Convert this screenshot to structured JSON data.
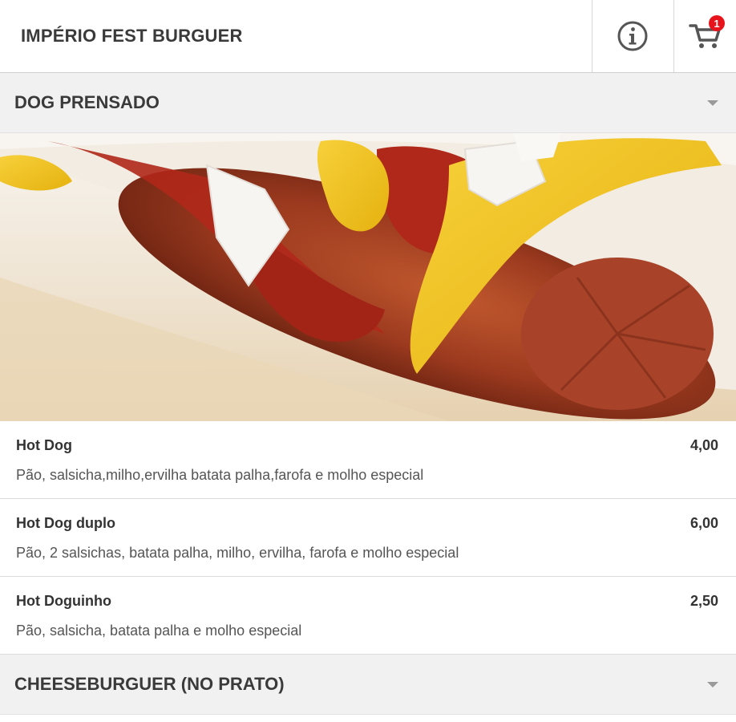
{
  "header": {
    "title": "IMPÉRIO FEST BURGUER",
    "info_icon": "info-icon",
    "cart_icon": "cart-icon",
    "cart_count": "1"
  },
  "categories": [
    {
      "title": "DOG PRENSADO",
      "items": [
        {
          "name": "Hot Dog",
          "description": "Pão, salsicha,milho,ervilha batata palha,farofa e molho especial",
          "price": "4,00"
        },
        {
          "name": "Hot Dog duplo",
          "description": "Pão, 2 salsichas, batata palha, milho, ervilha, farofa e molho especial",
          "price": "6,00"
        },
        {
          "name": "Hot Doguinho",
          "description": "Pão, salsicha, batata palha e molho especial",
          "price": "2,50"
        }
      ]
    },
    {
      "title": "CHEESEBURGUER (NO PRATO)"
    }
  ],
  "colors": {
    "badge": "#e8141b",
    "category_bg": "#f1f1f1",
    "mustard": "#f2c318",
    "ketchup": "#b0281a"
  }
}
